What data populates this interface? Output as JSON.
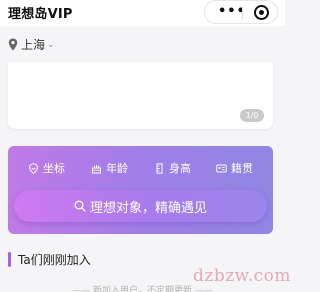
{
  "app": {
    "title": "理想岛VIP",
    "capsule_more": "•••"
  },
  "location": {
    "city": "上海",
    "chevron": "⌄"
  },
  "banner": {
    "counter": "1/0"
  },
  "filters": [
    {
      "label": "坐标",
      "icon": "location-face-icon"
    },
    {
      "label": "年龄",
      "icon": "cake-icon"
    },
    {
      "label": "身高",
      "icon": "ruler-icon"
    },
    {
      "label": "籍贯",
      "icon": "id-card-icon"
    }
  ],
  "search_button": {
    "label": "理想对象，精确遇见",
    "icon": "search-icon"
  },
  "section": {
    "title": "Ta们刚刚加入",
    "note": "—— 新加入用户，不定期更新 ——"
  },
  "watermark": "dzbzw.com",
  "colors": {
    "accent": "#a163e2",
    "card_gradient_start": "#c07ae6",
    "card_gradient_end": "#8f86e2"
  }
}
